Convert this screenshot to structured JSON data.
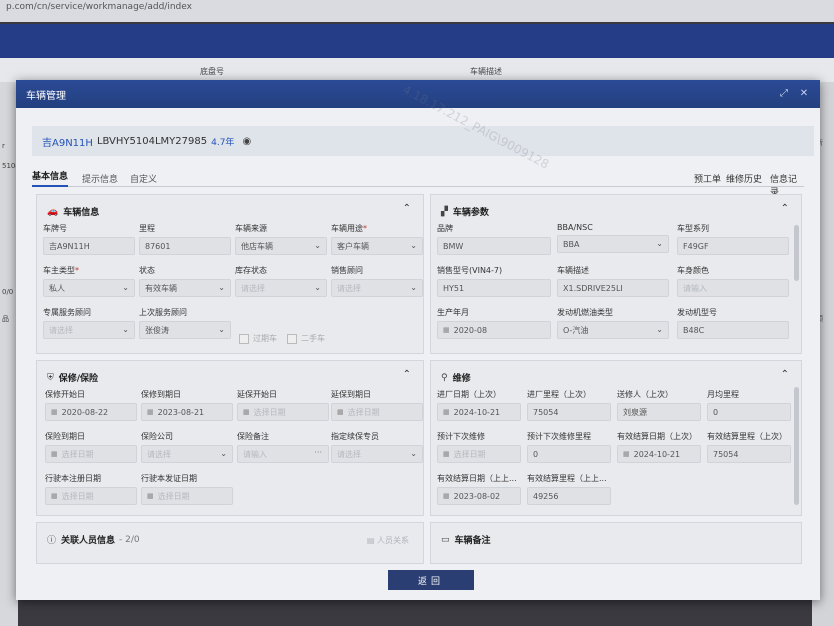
{
  "background": {
    "url": "p.com/cn/service/workmanage/add/index",
    "strip_col1": "底盘号",
    "strip_col2": "车辆描述",
    "left_labels": [
      "r",
      "5104",
      "0/0",
      "品"
    ],
    "right_labels": [
      "新",
      "ɔ",
      "预"
    ]
  },
  "modal": {
    "title": "车辆管理",
    "vehicle": {
      "plate": "吉A9N11H",
      "vin": "LBVHY5104LMY27985",
      "age": "4.7年"
    },
    "tabs": [
      "基本信息",
      "提示信息",
      "自定义"
    ],
    "right_links": [
      "预工单",
      "维修历史",
      "信息记录"
    ],
    "back_label": "返回",
    "watermark": "4.18.17.212_PAIG\\9009128"
  },
  "vehicle_info": {
    "title": "车辆信息",
    "fields": [
      {
        "label": "车牌号",
        "value": "吉A9N11H"
      },
      {
        "label": "里程",
        "value": "87601"
      },
      {
        "label": "车辆来源",
        "value": "他店车辆"
      },
      {
        "label": "车辆用途",
        "value": "客户车辆",
        "required": "*"
      },
      {
        "label": "车主类型",
        "value": "私人",
        "required": "*"
      },
      {
        "label": "状态",
        "value": "有效车辆"
      },
      {
        "label": "库存状态",
        "placeholder": "请选择"
      },
      {
        "label": "销售顾问",
        "placeholder": "请选择"
      },
      {
        "label": "专属服务顾问",
        "placeholder": "请选择"
      },
      {
        "label": "上次服务顾问",
        "value": "张俊涛"
      }
    ],
    "checkbox1": "过期车",
    "checkbox2": "二手车"
  },
  "vehicle_params": {
    "title": "车辆参数",
    "fields": [
      {
        "label": "品牌",
        "value": "BMW"
      },
      {
        "label": "BBA/NSC",
        "value": "BBA"
      },
      {
        "label": "车型系列",
        "value": "F49GF"
      },
      {
        "label": "销售型号(VIN4-7)",
        "value": "HY51"
      },
      {
        "label": "车辆描述",
        "value": "X1.SDRIVE25LI"
      },
      {
        "label": "车身颜色",
        "placeholder": "请输入"
      },
      {
        "label": "生产年月",
        "value": "2020-08"
      },
      {
        "label": "发动机燃油类型",
        "value": "O-汽油"
      },
      {
        "label": "发动机型号",
        "value": "B48C"
      }
    ]
  },
  "warranty": {
    "title": "保修/保险",
    "fields": [
      {
        "label": "保修开始日",
        "value": "2020-08-22"
      },
      {
        "label": "保修到期日",
        "value": "2023-08-21"
      },
      {
        "label": "延保开始日",
        "placeholder": "选择日期"
      },
      {
        "label": "延保到期日",
        "placeholder": "选择日期"
      },
      {
        "label": "保险到期日",
        "placeholder": "选择日期"
      },
      {
        "label": "保险公司",
        "placeholder": "请选择"
      },
      {
        "label": "保险备注",
        "placeholder": "请输入"
      },
      {
        "label": "指定续保专员",
        "placeholder": "请选择"
      },
      {
        "label": "行驶本注册日期",
        "placeholder": "选择日期"
      },
      {
        "label": "行驶本发证日期",
        "placeholder": "选择日期"
      }
    ]
  },
  "maintenance": {
    "title": "维修",
    "fields": [
      {
        "label": "进厂日期（上次）",
        "value": "2024-10-21"
      },
      {
        "label": "进厂里程（上次）",
        "value": "75054"
      },
      {
        "label": "送修人（上次）",
        "value": "刘泉源"
      },
      {
        "label": "月均里程",
        "value": "0"
      },
      {
        "label": "预计下次维修",
        "placeholder": "选择日期"
      },
      {
        "label": "预计下次维修里程",
        "value": "0"
      },
      {
        "label": "有效结算日期（上次）",
        "value": "2024-10-21"
      },
      {
        "label": "有效结算里程（上次）",
        "value": "75054"
      },
      {
        "label": "有效结算日期（上上...",
        "value": "2023-08-02"
      },
      {
        "label": "有效结算里程（上上...",
        "value": "49256"
      }
    ]
  },
  "related": {
    "title": "关联人员信息",
    "count": "- 2/0",
    "action": "人员关系"
  },
  "remarks": {
    "title": "车辆备注"
  }
}
